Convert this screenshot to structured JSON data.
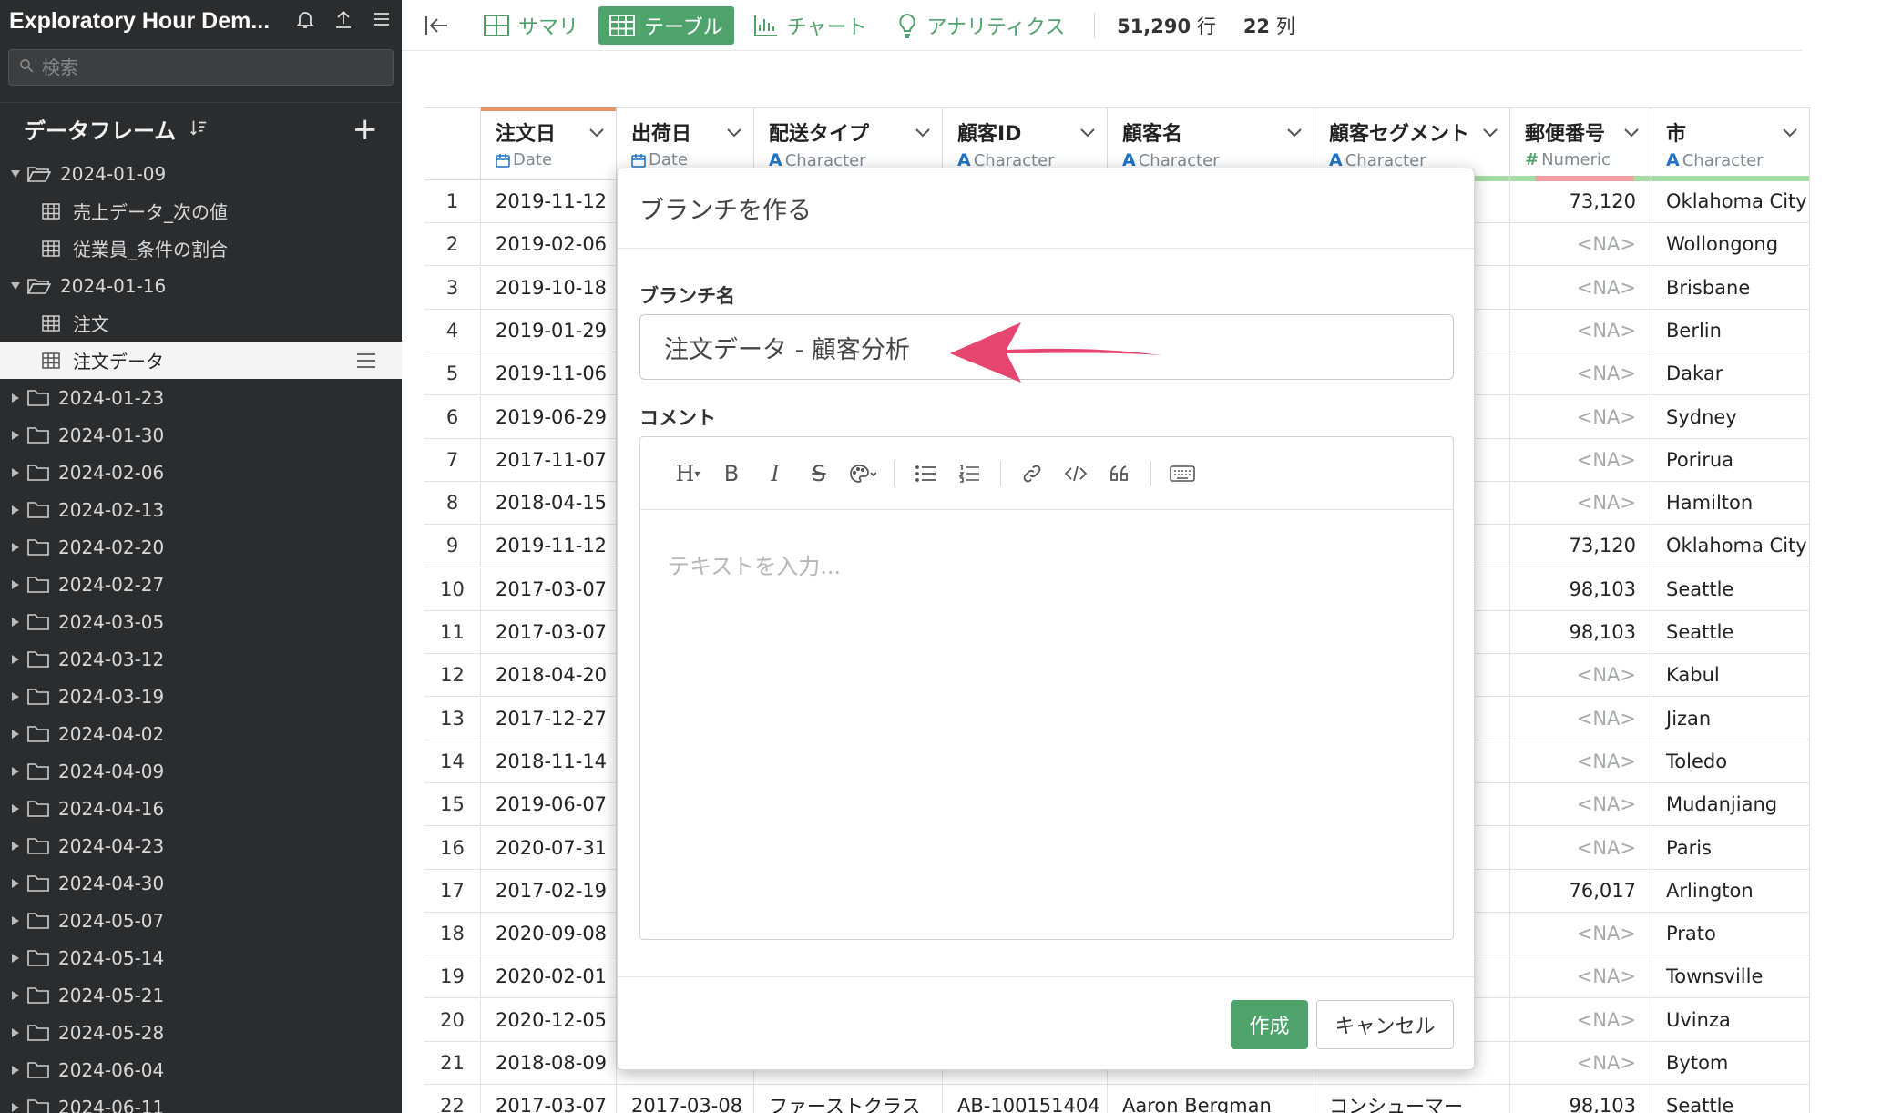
{
  "sidebar": {
    "title": "Exploratory Hour Dem...",
    "search_placeholder": "検索",
    "section_label": "データフレーム",
    "tree": [
      {
        "type": "folder",
        "open": true,
        "label": "2024-01-09"
      },
      {
        "type": "table",
        "label": "売上データ_次の値"
      },
      {
        "type": "table",
        "label": "従業員_条件の割合"
      },
      {
        "type": "folder",
        "open": true,
        "label": "2024-01-16"
      },
      {
        "type": "table",
        "label": "注文"
      },
      {
        "type": "table",
        "label": "注文データ",
        "selected": true
      },
      {
        "type": "folder",
        "open": false,
        "label": "2024-01-23"
      },
      {
        "type": "folder",
        "open": false,
        "label": "2024-01-30"
      },
      {
        "type": "folder",
        "open": false,
        "label": "2024-02-06"
      },
      {
        "type": "folder",
        "open": false,
        "label": "2024-02-13"
      },
      {
        "type": "folder",
        "open": false,
        "label": "2024-02-20"
      },
      {
        "type": "folder",
        "open": false,
        "label": "2024-02-27"
      },
      {
        "type": "folder",
        "open": false,
        "label": "2024-03-05"
      },
      {
        "type": "folder",
        "open": false,
        "label": "2024-03-12"
      },
      {
        "type": "folder",
        "open": false,
        "label": "2024-03-19"
      },
      {
        "type": "folder",
        "open": false,
        "label": "2024-04-02"
      },
      {
        "type": "folder",
        "open": false,
        "label": "2024-04-09"
      },
      {
        "type": "folder",
        "open": false,
        "label": "2024-04-16"
      },
      {
        "type": "folder",
        "open": false,
        "label": "2024-04-23"
      },
      {
        "type": "folder",
        "open": false,
        "label": "2024-04-30"
      },
      {
        "type": "folder",
        "open": false,
        "label": "2024-05-07"
      },
      {
        "type": "folder",
        "open": false,
        "label": "2024-05-14"
      },
      {
        "type": "folder",
        "open": false,
        "label": "2024-05-21"
      },
      {
        "type": "folder",
        "open": false,
        "label": "2024-05-28"
      },
      {
        "type": "folder",
        "open": false,
        "label": "2024-06-04"
      },
      {
        "type": "folder",
        "open": false,
        "label": "2024-06-11"
      }
    ]
  },
  "toolbar": {
    "tabs": [
      {
        "label": "サマリ",
        "icon": "summary-grid-icon",
        "active": false
      },
      {
        "label": "テーブル",
        "icon": "table-icon",
        "active": true
      },
      {
        "label": "チャート",
        "icon": "bar-chart-icon",
        "active": false
      },
      {
        "label": "アナリティクス",
        "icon": "lightbulb-icon",
        "active": false
      }
    ],
    "rows_value": "51,290",
    "rows_unit": "行",
    "cols_value": "22",
    "cols_unit": "列"
  },
  "colors": {
    "accent": "#4ea36b",
    "sidebar_bg": "#2b2c2d",
    "type_character": "#1f73c5",
    "na_text": "#a7aaad"
  },
  "table": {
    "columns": [
      {
        "name": "注文日",
        "type": "Date",
        "type_icon": "calendar-icon"
      },
      {
        "name": "出荷日",
        "type": "Date",
        "type_icon": "calendar-icon"
      },
      {
        "name": "配送タイプ",
        "type": "Character",
        "type_icon": "A"
      },
      {
        "name": "顧客ID",
        "type": "Character",
        "type_icon": "A"
      },
      {
        "name": "顧客名",
        "type": "Character",
        "type_icon": "A"
      },
      {
        "name": "顧客セグメント",
        "type": "Character",
        "type_icon": "A"
      },
      {
        "name": "郵便番号",
        "type": "Numeric",
        "type_icon": "#"
      },
      {
        "name": "市",
        "type": "Character",
        "type_icon": "A"
      }
    ],
    "rows": [
      {
        "n": "1",
        "order_date": "2019-11-12",
        "zip": "73,120",
        "city": "Oklahoma City"
      },
      {
        "n": "2",
        "order_date": "2019-02-06",
        "zip": "<NA>",
        "city": "Wollongong"
      },
      {
        "n": "3",
        "order_date": "2019-10-18",
        "zip": "<NA>",
        "city": "Brisbane"
      },
      {
        "n": "4",
        "order_date": "2019-01-29",
        "zip": "<NA>",
        "city": "Berlin"
      },
      {
        "n": "5",
        "order_date": "2019-11-06",
        "zip": "<NA>",
        "city": "Dakar"
      },
      {
        "n": "6",
        "order_date": "2019-06-29",
        "zip": "<NA>",
        "city": "Sydney"
      },
      {
        "n": "7",
        "order_date": "2017-11-07",
        "zip": "<NA>",
        "city": "Porirua"
      },
      {
        "n": "8",
        "order_date": "2018-04-15",
        "zip": "<NA>",
        "city": "Hamilton"
      },
      {
        "n": "9",
        "order_date": "2019-11-12",
        "zip": "73,120",
        "city": "Oklahoma City"
      },
      {
        "n": "10",
        "order_date": "2017-03-07",
        "zip": "98,103",
        "city": "Seattle"
      },
      {
        "n": "11",
        "order_date": "2017-03-07",
        "zip": "98,103",
        "city": "Seattle"
      },
      {
        "n": "12",
        "order_date": "2018-04-20",
        "zip": "<NA>",
        "city": "Kabul"
      },
      {
        "n": "13",
        "order_date": "2017-12-27",
        "zip": "<NA>",
        "city": "Jizan"
      },
      {
        "n": "14",
        "order_date": "2018-11-14",
        "zip": "<NA>",
        "city": "Toledo"
      },
      {
        "n": "15",
        "order_date": "2019-06-07",
        "zip": "<NA>",
        "city": "Mudanjiang"
      },
      {
        "n": "16",
        "order_date": "2020-07-31",
        "zip": "<NA>",
        "city": "Paris"
      },
      {
        "n": "17",
        "order_date": "2017-02-19",
        "zip": "76,017",
        "city": "Arlington"
      },
      {
        "n": "18",
        "order_date": "2020-09-08",
        "zip": "<NA>",
        "city": "Prato"
      },
      {
        "n": "19",
        "order_date": "2020-02-01",
        "zip": "<NA>",
        "city": "Townsville"
      },
      {
        "n": "20",
        "order_date": "2020-12-05",
        "zip": "<NA>",
        "city": "Uvinza"
      },
      {
        "n": "21",
        "order_date": "2018-08-09",
        "zip": "<NA>",
        "city": "Bytom"
      },
      {
        "n": "22",
        "order_date": "2017-03-07",
        "ship_date": "2017-03-08",
        "ship_type": "ファーストクラス",
        "customer_id": "AB-100151404",
        "customer_name": "Aaron Bergman",
        "segment": "コンシューマー",
        "zip": "98,103",
        "city": "Seattle"
      }
    ]
  },
  "modal": {
    "title": "ブランチを作る",
    "branch_label": "ブランチ名",
    "branch_value": "注文データ - 顧客分析",
    "comment_label": "コメント",
    "comment_placeholder": "テキストを入力...",
    "editor_tools": [
      "heading-icon",
      "bold-icon",
      "italic-icon",
      "strikethrough-icon",
      "color-palette-icon",
      "bullet-list-icon",
      "numbered-list-icon",
      "link-icon",
      "code-icon",
      "quote-icon",
      "keyboard-icon"
    ],
    "create_label": "作成",
    "cancel_label": "キャンセル"
  }
}
